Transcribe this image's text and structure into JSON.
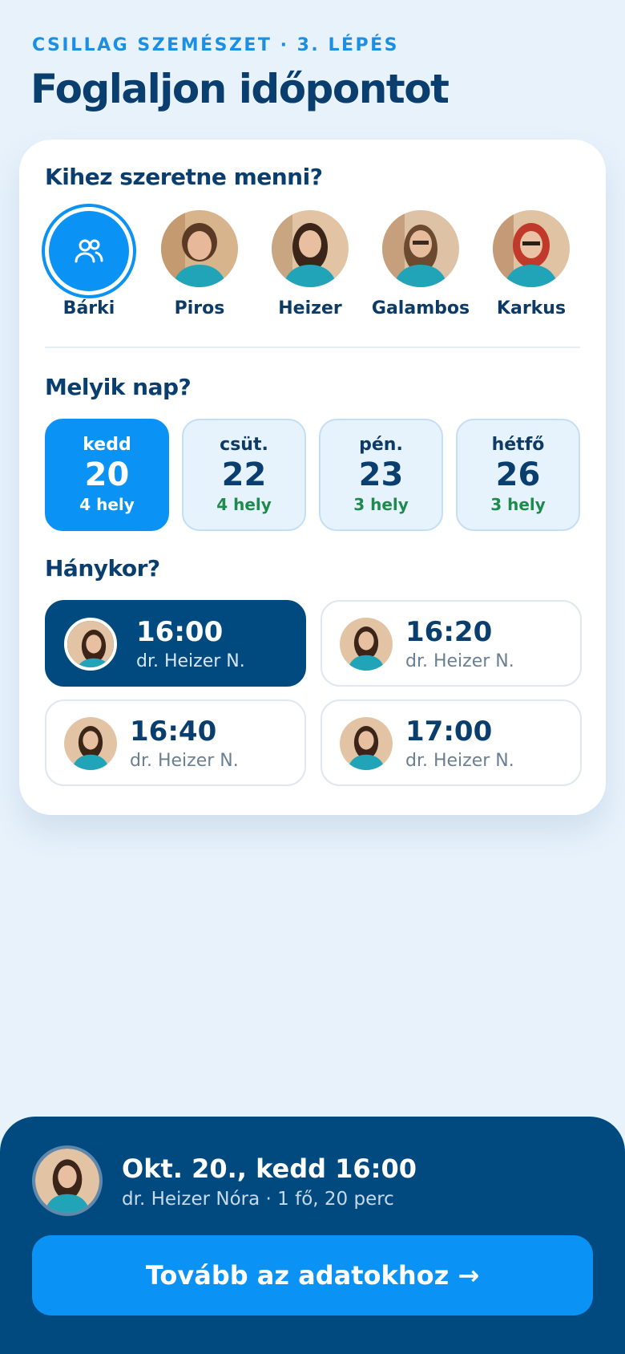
{
  "header": {
    "eyebrow": "CSILLAG SZEMÉSZET · 3. LÉPÉS",
    "title": "Foglaljon időpontot"
  },
  "doctor_section": {
    "title": "Kihez szeretne menni?",
    "doctors": [
      {
        "name": "Bárki",
        "selected": true,
        "icon": "people-icon"
      },
      {
        "name": "Piros",
        "selected": false
      },
      {
        "name": "Heizer",
        "selected": false
      },
      {
        "name": "Galambos",
        "selected": false
      },
      {
        "name": "Karkus",
        "selected": false
      }
    ]
  },
  "day_section": {
    "title": "Melyik nap?",
    "days": [
      {
        "day": "kedd",
        "date": "20",
        "slots": "4 hely",
        "selected": true
      },
      {
        "day": "csüt.",
        "date": "22",
        "slots": "4 hely",
        "selected": false
      },
      {
        "day": "pén.",
        "date": "23",
        "slots": "3 hely",
        "selected": false
      },
      {
        "day": "hétfő",
        "date": "26",
        "slots": "3 hely",
        "selected": false
      }
    ]
  },
  "time_section": {
    "title": "Hánykor?",
    "slots": [
      {
        "time": "16:00",
        "doctor": "dr. Heizer N.",
        "selected": true
      },
      {
        "time": "16:20",
        "doctor": "dr. Heizer N.",
        "selected": false
      },
      {
        "time": "16:40",
        "doctor": "dr. Heizer N.",
        "selected": false
      },
      {
        "time": "17:00",
        "doctor": "dr. Heizer N.",
        "selected": false
      }
    ]
  },
  "summary": {
    "title": "Okt. 20., kedd 16:00",
    "subtitle": "dr. Heizer Nóra · 1 fő, 20 perc",
    "cta_label": "Tovább az adatokhoz →"
  },
  "colors": {
    "accent": "#0a93f5",
    "navy": "#004a7f",
    "background": "#e8f2fb",
    "slots_green": "#1f8a4c"
  }
}
